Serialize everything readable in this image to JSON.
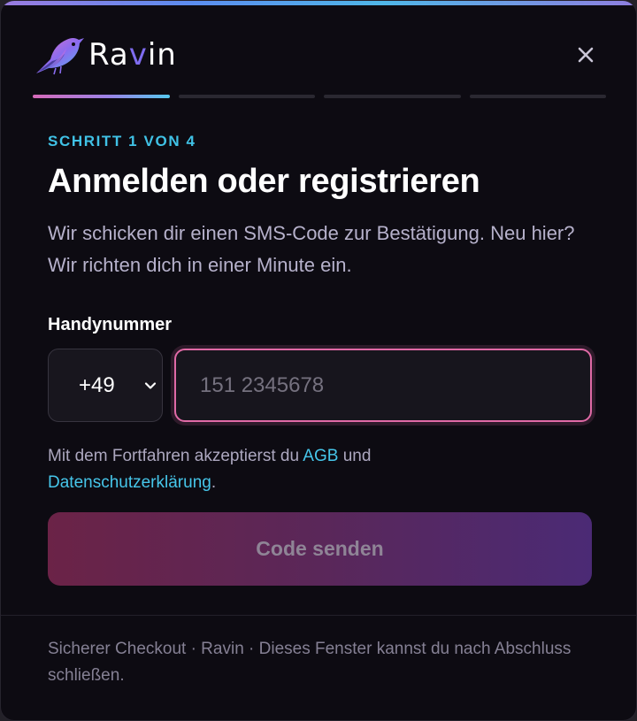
{
  "brand": {
    "name_prefix": "Ra",
    "name_accent": "v",
    "name_suffix": "in"
  },
  "header": {
    "close_icon": "close-icon"
  },
  "progress": {
    "current_step": 1,
    "total_steps": 4
  },
  "step_label": "SCHRITT 1 VON 4",
  "title": "Anmelden oder registrieren",
  "subtitle": "Wir schicken dir einen SMS-Code zur Bestätigung. Neu hier? Wir richten dich in einer Minute ein.",
  "phone": {
    "label": "Handynummer",
    "country_code": "+49",
    "placeholder": "151 2345678",
    "value": ""
  },
  "terms": {
    "prefix": "Mit dem Fortfahren akzeptierst du ",
    "agb_link": "AGB",
    "middle": " und",
    "privacy_link": "Datenschutzerklärung",
    "suffix": "."
  },
  "submit": {
    "label": "Code senden"
  },
  "footer": {
    "text": "Sicherer Checkout · Ravin · Dieses Fenster kannst du nach Abschluss schließen."
  },
  "colors": {
    "background": "#0d0b12",
    "accent_cyan": "#40c2e6",
    "accent_pink": "#e06aa6",
    "accent_purple": "#7f6cf0",
    "button_gradient_start": "#6b2347",
    "button_gradient_end": "#4b2a75"
  }
}
